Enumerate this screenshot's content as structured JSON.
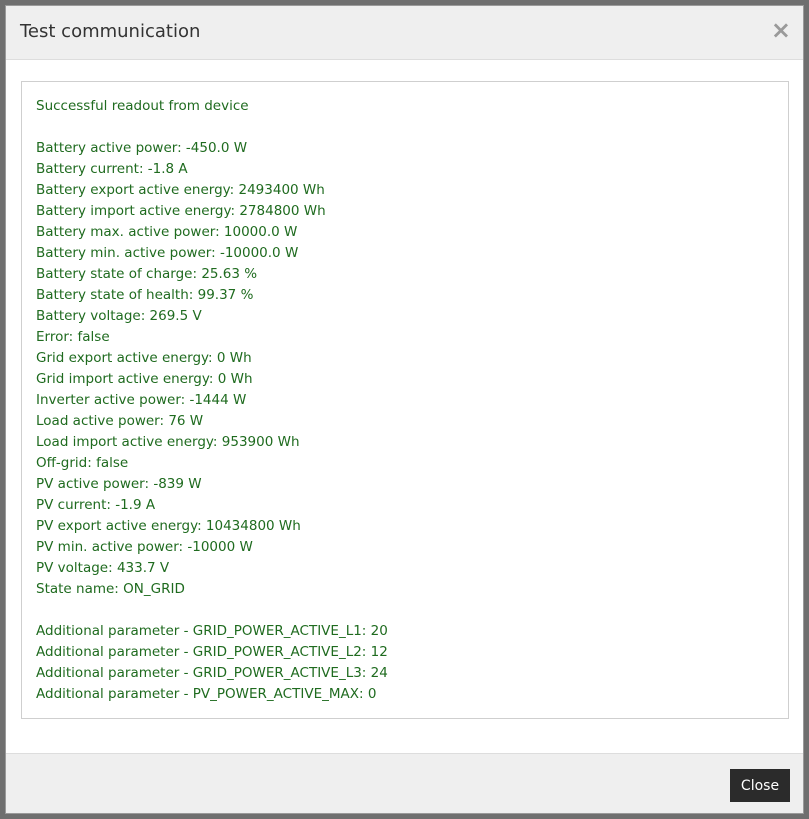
{
  "dialog": {
    "title": "Test communication",
    "close_symbol": "×",
    "close_button_label": "Close"
  },
  "readout": {
    "status": "Successful readout from device",
    "values": [
      "Battery active power: -450.0 W",
      "Battery current: -1.8 A",
      "Battery export active energy: 2493400 Wh",
      "Battery import active energy: 2784800 Wh",
      "Battery max. active power: 10000.0 W",
      "Battery min. active power: -10000.0 W",
      "Battery state of charge: 25.63 %",
      "Battery state of health: 99.37 %",
      "Battery voltage: 269.5 V",
      "Error: false",
      "Grid export active energy: 0 Wh",
      "Grid import active energy: 0 Wh",
      "Inverter active power: -1444 W",
      "Load active power: 76 W",
      "Load import active energy: 953900 Wh",
      "Off-grid: false",
      "PV active power: -839 W",
      "PV current: -1.9 A",
      "PV export active energy: 10434800 Wh",
      "PV min. active power: -10000 W",
      "PV voltage: 433.7 V",
      "State name: ON_GRID"
    ],
    "additional": [
      "Additional parameter - GRID_POWER_ACTIVE_L1: 20",
      "Additional parameter - GRID_POWER_ACTIVE_L2: 12",
      "Additional parameter - GRID_POWER_ACTIVE_L3: 24",
      "Additional parameter - PV_POWER_ACTIVE_MAX: 0"
    ]
  },
  "colors": {
    "text_success": "#1f6b1f",
    "button_bg": "#2b2b2b",
    "header_bg": "#efefef"
  }
}
